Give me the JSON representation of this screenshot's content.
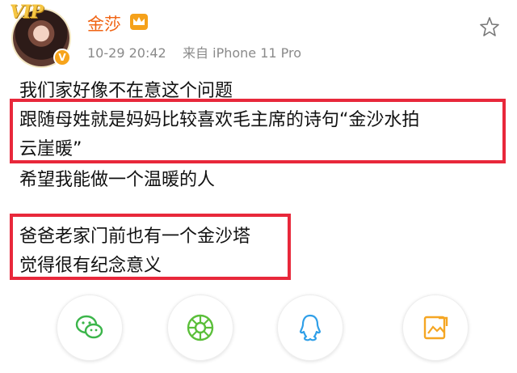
{
  "user": {
    "badge_text": "VIP",
    "name": "金莎",
    "timestamp": "10-29 20:42",
    "source": "来自 iPhone 11 Pro"
  },
  "post": {
    "lines": [
      "我们家好像不在意这个问题",
      "跟随母姓就是妈妈比较喜欢毛主席的诗句“金沙水拍",
      "云崖暖”",
      "希望我能做一个温暖的人",
      "爸爸老家门前也有一个金沙塔",
      "觉得很有纪念意义"
    ]
  },
  "share": [
    {
      "icon": "wechat-icon",
      "color": "#3bb54a"
    },
    {
      "icon": "moments-icon",
      "color": "#5bbf3a"
    },
    {
      "icon": "qq-icon",
      "color": "#2f9fe8"
    },
    {
      "icon": "qzone-icon",
      "color": "#f5a623"
    }
  ],
  "colors": {
    "username": "#f06414",
    "highlight": "#e8283b",
    "meta": "#8a8a8a"
  }
}
